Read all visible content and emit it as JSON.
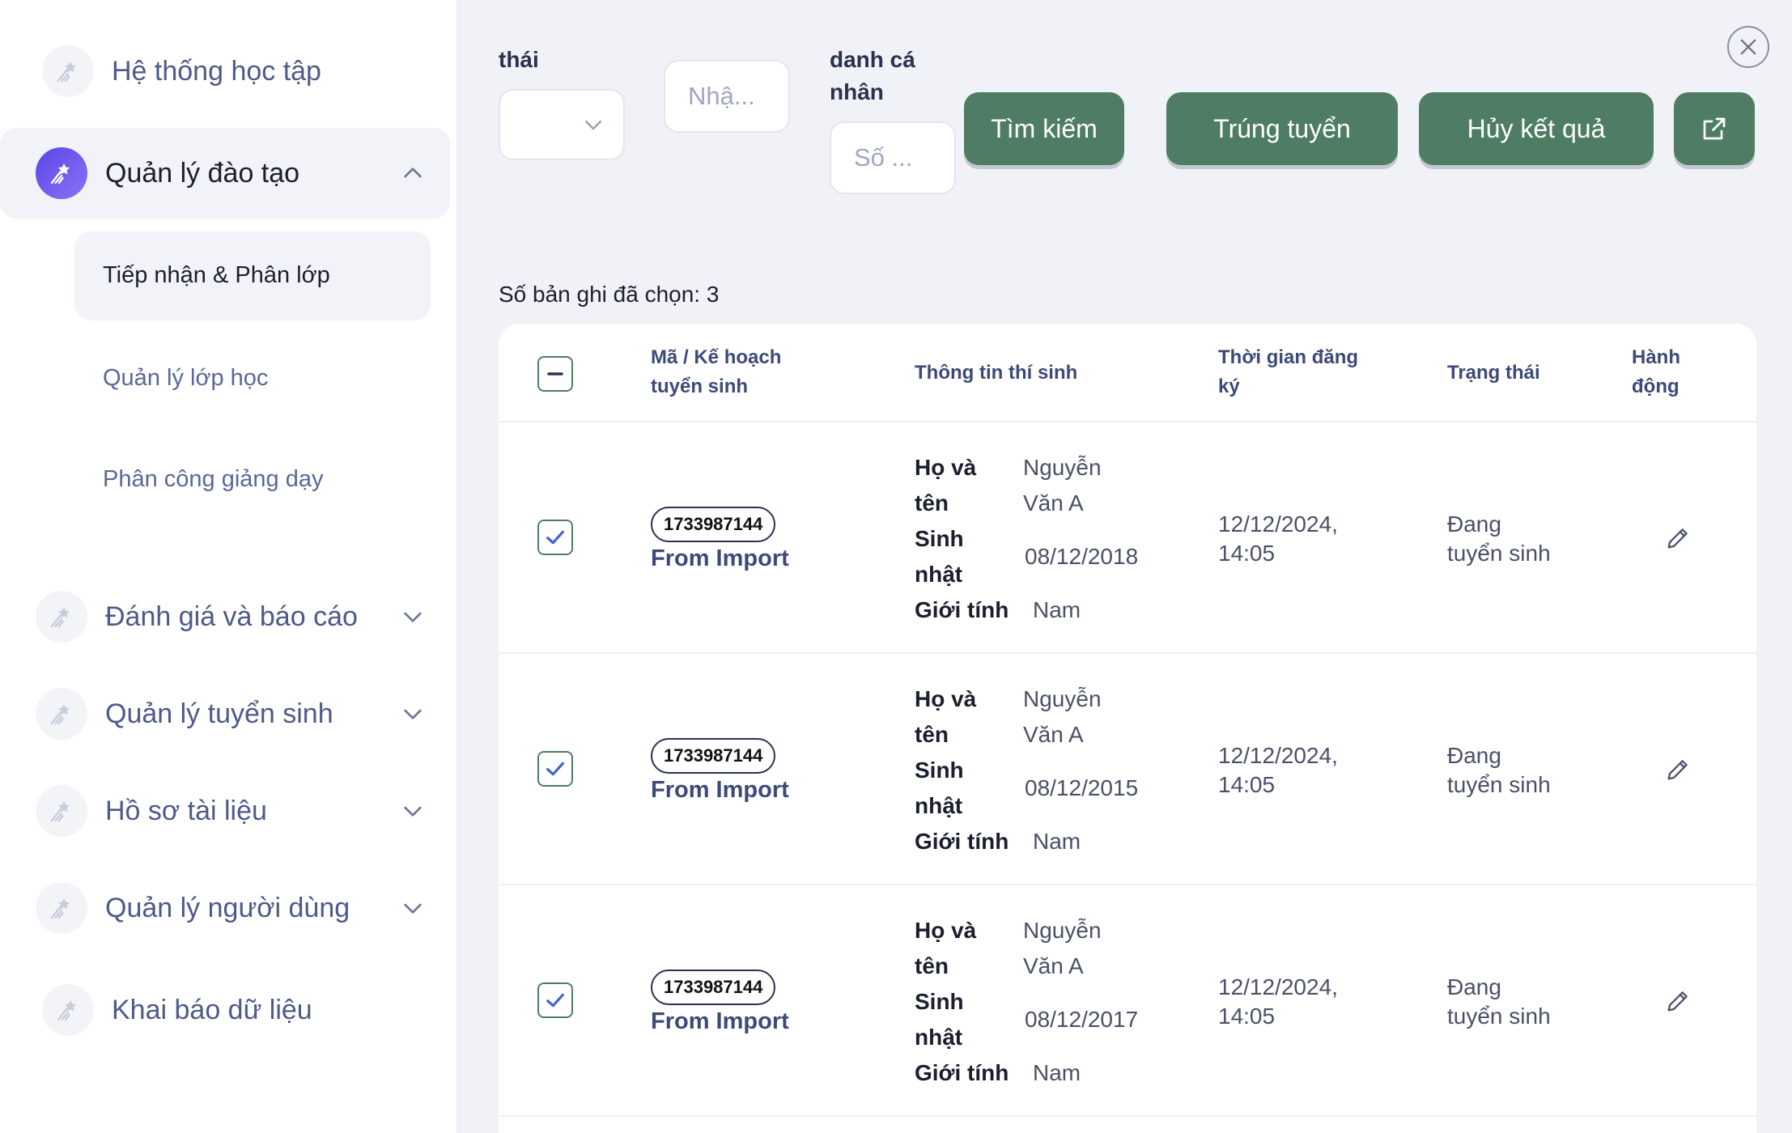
{
  "sidebar": {
    "items": [
      {
        "label": "Hệ thống học tập"
      },
      {
        "label": "Quản lý đào tạo"
      },
      {
        "label": "Đánh giá và báo cáo"
      },
      {
        "label": "Quản lý tuyển sinh"
      },
      {
        "label": "Hồ sơ tài liệu"
      },
      {
        "label": "Quản lý người dùng"
      },
      {
        "label": "Khai báo dữ liệu"
      }
    ],
    "subitems": [
      {
        "label": "Tiếp nhận & Phân lớp"
      },
      {
        "label": "Quản lý lớp học"
      },
      {
        "label": "Phân công giảng dạy"
      }
    ]
  },
  "filters": {
    "status_label": "thái",
    "source_placeholder": "Nhậ...",
    "id_label_line1": "danh cá",
    "id_label_line2": "nhân",
    "id_placeholder": "Số ..."
  },
  "toolbar": {
    "search_label": "Tìm kiếm",
    "admit_label": "Trúng tuyển",
    "cancel_label": "Hủy kết quả"
  },
  "selection": {
    "count_text": "Số bản ghi đã chọn: 3"
  },
  "table": {
    "headers": {
      "plan_line1": "Mã / Kế hoạch",
      "plan_line2": "tuyển sinh",
      "info": "Thông tin thí sinh",
      "time_line1": "Thời gian đăng",
      "time_line2": "ký",
      "status": "Trạng thái",
      "action_line1": "Hành",
      "action_line2": "động"
    },
    "field_labels": {
      "name_line1": "Họ và",
      "name_line2": "tên",
      "dob_line1": "Sinh",
      "dob_line2": "nhật",
      "gender": "Giới tính"
    },
    "rows": [
      {
        "code": "1733987144",
        "source": "From Import",
        "name_line1": "Nguyễn",
        "name_line2": "Văn A",
        "dob": "08/12/2018",
        "gender": "Nam",
        "date": "12/12/2024,",
        "time": "14:05",
        "status_line1": "Đang",
        "status_line2": "tuyển sinh"
      },
      {
        "code": "1733987144",
        "source": "From Import",
        "name_line1": "Nguyễn",
        "name_line2": "Văn A",
        "dob": "08/12/2015",
        "gender": "Nam",
        "date": "12/12/2024,",
        "time": "14:05",
        "status_line1": "Đang",
        "status_line2": "tuyển sinh"
      },
      {
        "code": "1733987144",
        "source": "From Import",
        "name_line1": "Nguyễn",
        "name_line2": "Văn A",
        "dob": "08/12/2017",
        "gender": "Nam",
        "date": "12/12/2024,",
        "time": "14:05",
        "status_line1": "Đang",
        "status_line2": "tuyển sinh"
      }
    ]
  },
  "colors": {
    "primary": "#4e7d63",
    "accent": "#5a46e6",
    "sidebar_text": "#4d5a8a"
  }
}
